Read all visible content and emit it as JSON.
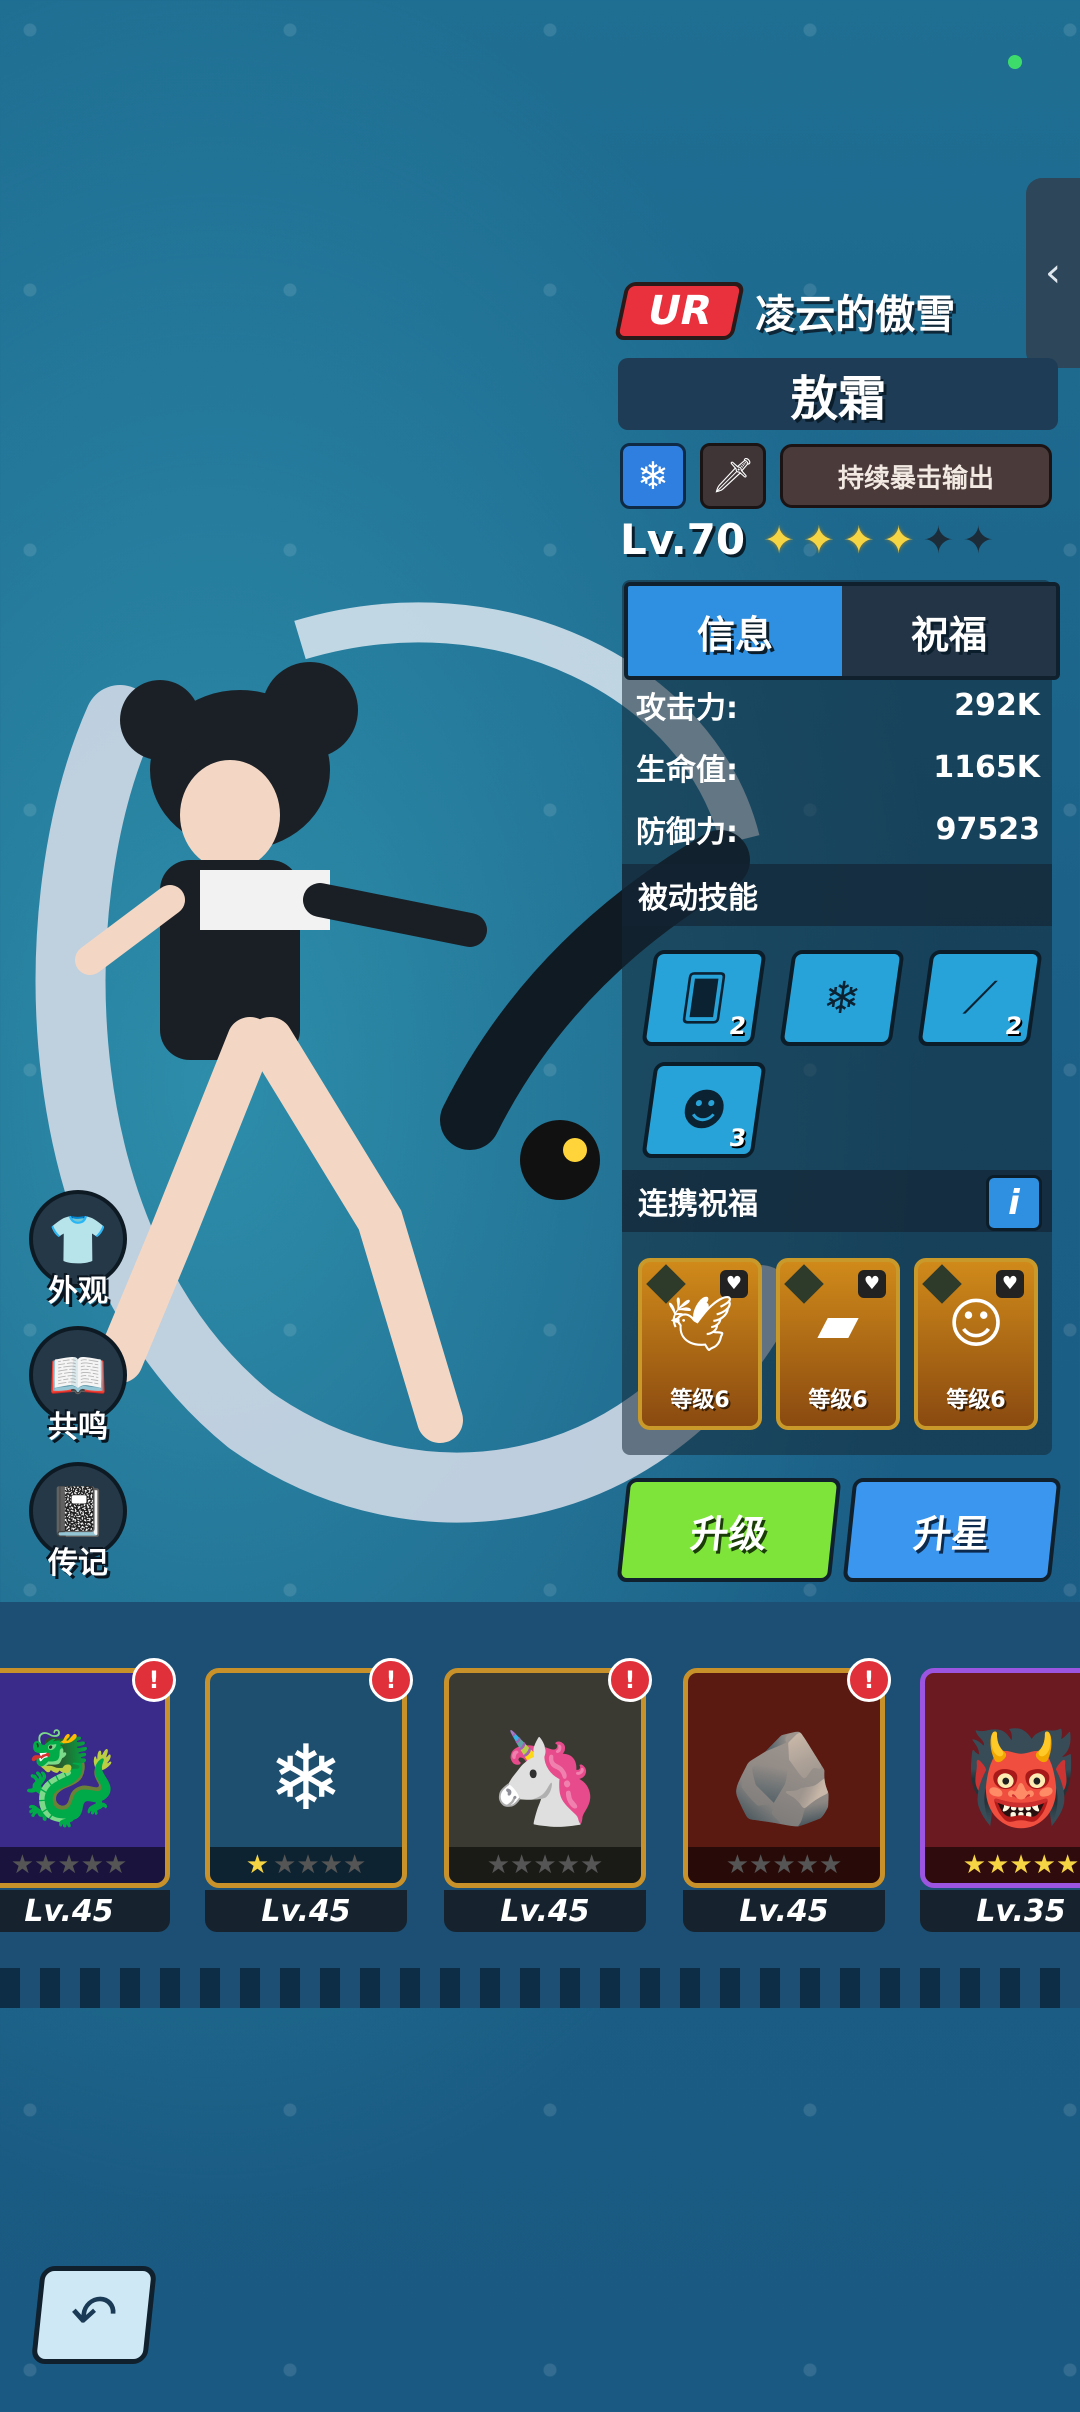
{
  "hero": {
    "rarity": "UR",
    "subtitle": "凌云的傲雪",
    "name": "敖霜",
    "element_icon": "snowflake-icon",
    "class_icon": "sword-icon",
    "role": "持续暴击输出",
    "level": "Lv.70",
    "stars": 4,
    "max_stars": 6
  },
  "tabs": [
    {
      "label": "信息",
      "active": true
    },
    {
      "label": "祝福",
      "active": false
    }
  ],
  "stats": [
    {
      "label": "攻击力:",
      "value": "292K"
    },
    {
      "label": "生命值:",
      "value": "1165K"
    },
    {
      "label": "防御力:",
      "value": "97523"
    }
  ],
  "passive_skills": {
    "title": "被动技能",
    "skills": [
      {
        "icon": "card-snowflake-icon",
        "count": "2"
      },
      {
        "icon": "snowflake-icon",
        "count": ""
      },
      {
        "icon": "claw-icon",
        "count": "2"
      },
      {
        "icon": "demon-mask-icon",
        "count": "3"
      }
    ]
  },
  "combo_blessing": {
    "title": "连携祝福",
    "info_label": "i",
    "cards": [
      {
        "label": "等级6",
        "icon": "winged-creature-icon"
      },
      {
        "label": "等级6",
        "icon": "gold-bar-icon"
      },
      {
        "label": "等级6",
        "icon": "demon-icon"
      }
    ]
  },
  "buttons": {
    "upgrade": "升级",
    "star_up": "升星"
  },
  "side_menu": [
    {
      "label": "外观",
      "icon": "shirt-icon"
    },
    {
      "label": "共鸣",
      "icon": "book-icon"
    },
    {
      "label": "传记",
      "icon": "journal-icon"
    }
  ],
  "hero_roster": [
    {
      "level": "Lv.45",
      "stars": 0,
      "alert": "!",
      "portrait": "purple-dragon-icon",
      "frame": "#c9912a"
    },
    {
      "level": "Lv.45",
      "stars": 1,
      "alert": "!",
      "portrait": "ice-crystal-beast-icon",
      "frame": "#c9912a"
    },
    {
      "level": "Lv.45",
      "stars": 0,
      "alert": "!",
      "portrait": "golden-horn-icon",
      "frame": "#c9912a"
    },
    {
      "level": "Lv.45",
      "stars": 0,
      "alert": "!",
      "portrait": "lava-rock-icon",
      "frame": "#c9912a"
    },
    {
      "level": "Lv.35",
      "stars": 5,
      "alert": "",
      "portrait": "red-horned-monster-icon",
      "frame": "#9b55e0"
    }
  ],
  "colors": {
    "accent_blue": "#2f8fe0",
    "upgrade_green": "#7fe43a",
    "rarity_red": "#e8313d",
    "star_gold": "#f6d545"
  }
}
